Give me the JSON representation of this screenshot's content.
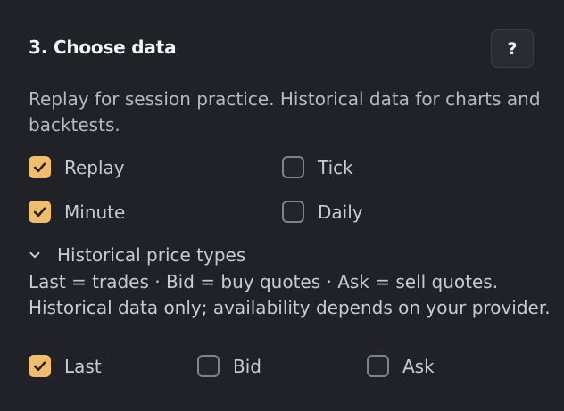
{
  "section": {
    "title": "3. Choose data",
    "help_label": "?",
    "description": "Replay for session practice. Historical data for charts and backtests."
  },
  "data_types": [
    {
      "label": "Replay",
      "checked": true
    },
    {
      "label": "Tick",
      "checked": false
    },
    {
      "label": "Minute",
      "checked": true
    },
    {
      "label": "Daily",
      "checked": false
    }
  ],
  "price_types": {
    "toggle_label": "Historical price types",
    "expanded": true,
    "info_line1": "Last = trades · Bid = buy quotes · Ask = sell quotes.",
    "info_line2": "Historical data only; availability depends on your provider.",
    "options": [
      {
        "label": "Last",
        "checked": true
      },
      {
        "label": "Bid",
        "checked": false
      },
      {
        "label": "Ask",
        "checked": false
      }
    ]
  },
  "colors": {
    "background": "#202227",
    "accent": "#efbd70",
    "checkmark": "#2a2113"
  },
  "icons": {
    "check": "checkmark-icon",
    "disclosure": "chevron-down-icon"
  }
}
